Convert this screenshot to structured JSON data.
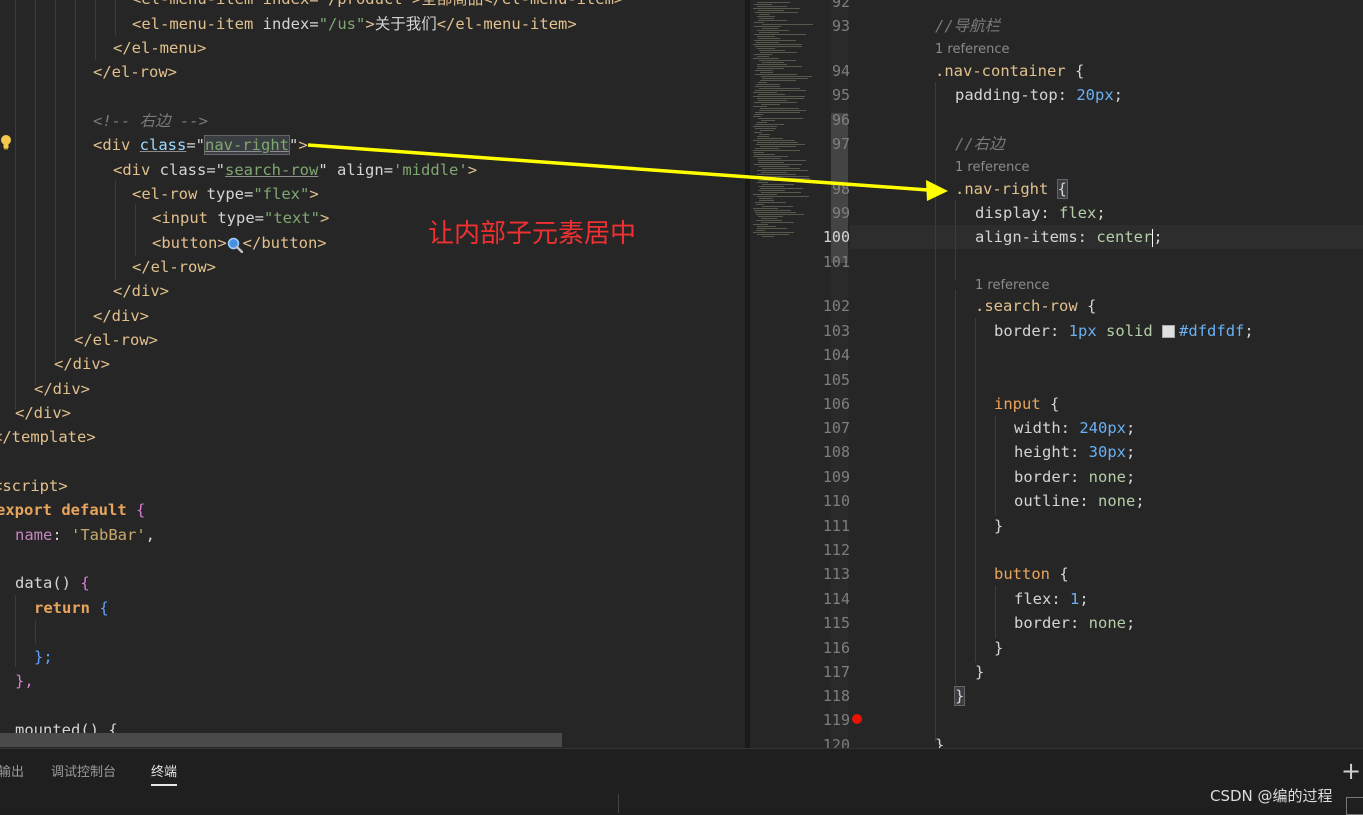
{
  "left_code": {
    "l0": "<el-menu-item index=\"/product\">全部商品</el-menu-item>",
    "l1_tag_open": "<el-menu-item",
    "l1_attr": "index",
    "l1_val": "\"/us\"",
    "l1_text": "关于我们",
    "l1_tag_close": "</el-menu-item>",
    "l2": "</el-menu>",
    "l3": "</el-row>",
    "l5_comment": "<!-- 右边 -->",
    "l6_tag": "<div",
    "l6_attr": "class",
    "l6_val": "nav-right",
    "l6_end": ">",
    "l7_tag": "<div",
    "l7_attr": "class",
    "l7_val": "search-row",
    "l7_attr2": "align",
    "l7_val2": "'middle'",
    "l7_end": ">",
    "l8_tag": "<el-row",
    "l8_attr": "type",
    "l8_val": "\"flex\"",
    "l8_end": ">",
    "l9_tag": "<input",
    "l9_attr": "type",
    "l9_val": "\"text\"",
    "l9_end": ">",
    "l10_open": "<button>",
    "l10_close": "</button>",
    "l11": "</el-row>",
    "l12": "</div>",
    "l13": "</div>",
    "l14": "</el-row>",
    "l15": "</div>",
    "l16": "</div>",
    "l17": "</div>",
    "l18": "</template>",
    "l20": "<script>",
    "l21_kw1": "export",
    "l21_kw2": "default",
    "l21_brace": "{",
    "l22_prop": "name",
    "l22_colon": ":",
    "l22_val": "'TabBar'",
    "l22_comma": ",",
    "l24_fn": "data()",
    "l24_brace": "{",
    "l25_kw": "return",
    "l25_brace": "{",
    "l27": "};",
    "l28": "},",
    "l30": "mounted() {"
  },
  "annotation": {
    "text": "让内部子元素居中",
    "color": "#f03030"
  },
  "right_code": {
    "line_numbers": [
      "92",
      "93",
      "94",
      "95",
      "96",
      "97",
      "98",
      "99",
      "100",
      "101",
      "102",
      "103",
      "104",
      "105",
      "106",
      "107",
      "108",
      "109",
      "110",
      "111",
      "112",
      "113",
      "114",
      "115",
      "116",
      "117",
      "118",
      "119",
      "120"
    ],
    "active_line": "100",
    "refhint": "1 reference",
    "c93": "//导航栏",
    "c94_sel": ".nav-container",
    "c94_brace": "{",
    "c95_prop": "padding-top",
    "c95_num": "20",
    "c95_unit": "px",
    "c97": "//右边",
    "c98_sel": ".nav-right",
    "c98_brace": "{",
    "c99_prop": "display",
    "c99_val": "flex",
    "c100_prop": "align-items",
    "c100_val": "center",
    "c102_sel": ".search-row",
    "c102_brace": "{",
    "c103_prop": "border",
    "c103_num": "1",
    "c103_unit": "px",
    "c103_kw": "solid",
    "c103_color": "#dfdfdf",
    "c106_sel": "input",
    "c106_brace": "{",
    "c107_prop": "width",
    "c107_num": "240",
    "c107_unit": "px",
    "c108_prop": "height",
    "c108_num": "30",
    "c108_unit": "px",
    "c109_prop": "border",
    "c109_val": "none",
    "c110_prop": "outline",
    "c110_val": "none",
    "c111": "}",
    "c113_sel": "button",
    "c113_brace": "{",
    "c114_prop": "flex",
    "c114_num": "1",
    "c115_prop": "border",
    "c115_val": "none",
    "c116": "}",
    "c117": "}",
    "c118": "}",
    "c120": "}"
  },
  "bottom_panel": {
    "tabs": [
      "输出",
      "调试控制台",
      "终端"
    ],
    "active_tab": "终端"
  },
  "watermark": "CSDN @编的过程"
}
